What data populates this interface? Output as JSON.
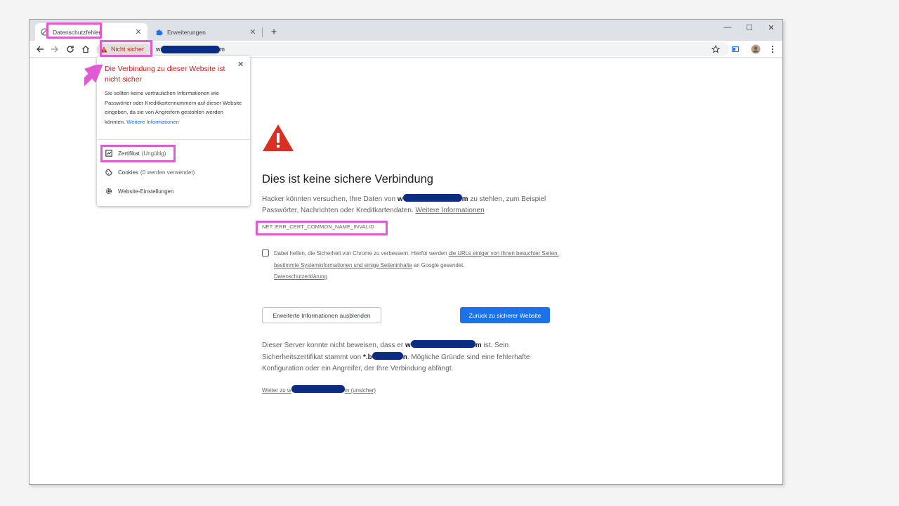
{
  "tabs": [
    {
      "label": "Datenschutzfehler",
      "active": true,
      "icon": "error-globe-icon"
    },
    {
      "label": "Erweiterungen",
      "active": false,
      "icon": "puzzle-icon"
    }
  ],
  "tab_close": "✕",
  "new_tab": "+",
  "window_controls": {
    "minimize": "—",
    "maximize": "☐",
    "close": "✕"
  },
  "toolbar": {
    "security_chip": "Nicht sicher",
    "url_prefix": "w",
    "url_suffix": "m"
  },
  "popup": {
    "title": "Die Verbindung zu dieser Website ist nicht sicher",
    "body": "Sie sollten keine vertraulichen Informationen wie Passwörter oder Kreditkartennummern auf dieser Website eingeben, da sie von Angreifern gestohlen werden könnten.",
    "more_link": "Weitere Informationen",
    "close": "✕",
    "certificate_label": "Zertifikat",
    "certificate_status": "(Ungültig)",
    "cookies_label": "Cookies",
    "cookies_status": "(0 werden verwendet)",
    "site_settings_label": "Website-Einstellungen"
  },
  "interstitial": {
    "heading": "Dies ist keine sichere Verbindung",
    "p1_before": "Hacker könnten versuchen, Ihre Daten von ",
    "p1_host_start": "w",
    "p1_host_end": "m",
    "p1_after": " zu stehlen, zum Beispiel Passwörter, Nachrichten oder Kreditkartendaten. ",
    "p1_link": "Weitere Informationen",
    "error_code": "NET::ERR_CERT_COMMON_NAME_INVALID",
    "check_before": "Dabei helfen, die Sicherheit von Chrome zu verbessern. Hierfür werden ",
    "check_link": "die URLs einiger von Ihnen besuchter Seiten, bestimmte Systeminformationen und einige Seiteninhalte",
    "check_after": " an Google gesendet. ",
    "privacy_link": "Datenschutzerklärung",
    "btn_hide": "Erweiterte Informationen ausblenden",
    "btn_back": "Zurück zu sicherer Website",
    "p3_before": "Dieser Server konnte nicht beweisen, dass er ",
    "p3_host_start": "w",
    "p3_host_end": "m",
    "p3_mid": " ist. Sein Sicherheitszertifikat stammt von ",
    "p3_cert_start": "*.b",
    "p3_cert_end": "n",
    "p3_after": ". Mögliche Gründe sind eine fehlerhafte Konfiguration oder ein Angreifer, der Ihre Verbindung abfängt.",
    "proceed_start": "Weiter zu w",
    "proceed_end": "m (unsicher)"
  },
  "colors": {
    "accent": "#1a73e8",
    "danger": "#c5221f",
    "warning_icon": "#d93025",
    "highlight": "#e05bd2",
    "redaction": "#0b2c83"
  }
}
